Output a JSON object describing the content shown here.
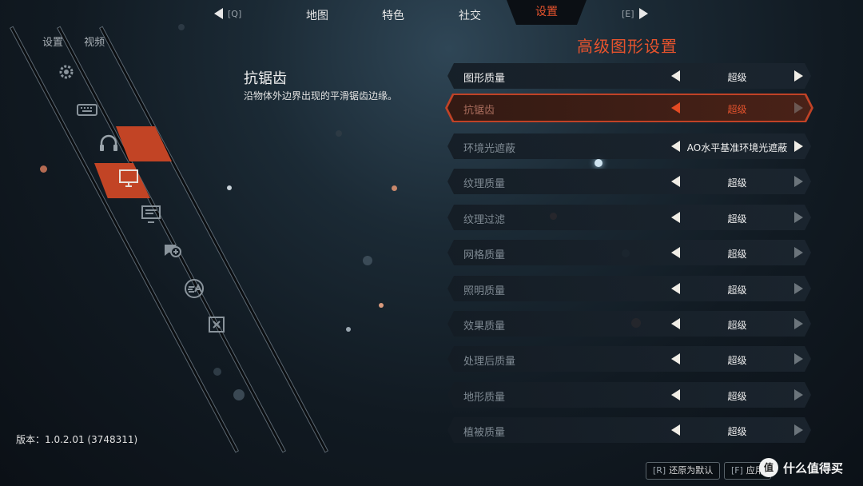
{
  "nav": {
    "prev_hint": "[Q]",
    "next_hint": "[E]",
    "tabs": [
      "地图",
      "特色",
      "社交",
      "设置"
    ],
    "active_tab": "设置"
  },
  "breadcrumb": [
    "设置",
    "视频"
  ],
  "sidebar_icons": [
    "gear-icon",
    "keyboard-icon",
    "headphones-icon",
    "monitor-icon",
    "display-icon",
    "chat-plus-icon",
    "ea-logo-icon",
    "close-box-icon"
  ],
  "description": {
    "title": "抗锯齿",
    "text": "沿物体外边界出现的平滑锯齿边缘。"
  },
  "panel": {
    "title": "高级图形设置",
    "rows": [
      {
        "label": "图形质量",
        "value": "超级"
      },
      {
        "label": "抗锯齿",
        "value": "超级"
      },
      {
        "label": "环境光遮蔽",
        "value": "AO水平基准环境光遮蔽"
      },
      {
        "label": "纹理质量",
        "value": "超级"
      },
      {
        "label": "纹理过滤",
        "value": "超级"
      },
      {
        "label": "网格质量",
        "value": "超级"
      },
      {
        "label": "照明质量",
        "value": "超级"
      },
      {
        "label": "效果质量",
        "value": "超级"
      },
      {
        "label": "处理后质量",
        "value": "超级"
      },
      {
        "label": "地形质量",
        "value": "超级"
      },
      {
        "label": "植被质量",
        "value": "超级"
      }
    ]
  },
  "version": "版本：1.0.2.01 (3748311)",
  "bottom": {
    "reset_key": "[R]",
    "reset_label": "还原为默认",
    "apply_key": "[F]",
    "apply_label": "应用"
  },
  "watermark": {
    "badge": "值",
    "text": "什么值得买"
  },
  "colors": {
    "accent": "#e6532d",
    "background": "#111a22"
  }
}
